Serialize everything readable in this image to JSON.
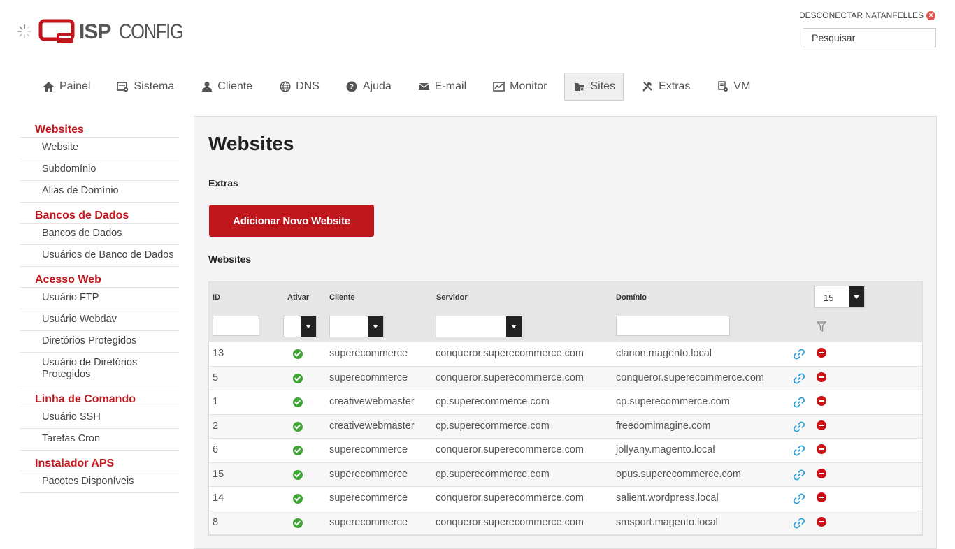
{
  "header": {
    "logo_text_bold": "ISP",
    "logo_text_light": "CONFIG",
    "logout_label": "DESCONECTAR NATANFELLES",
    "search_placeholder": "Pesquisar"
  },
  "nav": [
    {
      "label": "Painel",
      "icon": "home-icon"
    },
    {
      "label": "Sistema",
      "icon": "system-icon"
    },
    {
      "label": "Cliente",
      "icon": "user-icon"
    },
    {
      "label": "DNS",
      "icon": "globe-icon"
    },
    {
      "label": "Ajuda",
      "icon": "help-icon"
    },
    {
      "label": "E-mail",
      "icon": "envelope-icon"
    },
    {
      "label": "Monitor",
      "icon": "monitor-icon"
    },
    {
      "label": "Sites",
      "icon": "folder-icon",
      "active": true
    },
    {
      "label": "Extras",
      "icon": "tools-icon"
    },
    {
      "label": "VM",
      "icon": "vm-icon"
    }
  ],
  "sidebar": [
    {
      "title": "Websites",
      "items": [
        "Website",
        "Subdomínio",
        "Alias de Domínio"
      ]
    },
    {
      "title": "Bancos de Dados",
      "items": [
        "Bancos de Dados",
        "Usuários de Banco de Dados"
      ]
    },
    {
      "title": "Acesso Web",
      "items": [
        "Usuário FTP",
        "Usuário Webdav",
        "Diretórios Protegidos",
        "Usuário de Diretórios Protegidos"
      ]
    },
    {
      "title": "Linha de Comando",
      "items": [
        "Usuário SSH",
        "Tarefas Cron"
      ]
    },
    {
      "title": "Instalador APS",
      "items": [
        "Pacotes Disponíveis"
      ]
    }
  ],
  "main": {
    "title": "Websites",
    "extras_label": "Extras",
    "add_button": "Adicionar Novo Website",
    "list_label": "Websites",
    "columns": {
      "id": "ID",
      "active": "Ativar",
      "client": "Cliente",
      "server": "Servidor",
      "domain": "Domínio"
    },
    "per_page": "15",
    "rows": [
      {
        "id": "13",
        "client": "superecommerce",
        "server": "conqueror.superecommerce.com",
        "domain": "clarion.magento.local"
      },
      {
        "id": "5",
        "client": "superecommerce",
        "server": "conqueror.superecommerce.com",
        "domain": "conqueror.superecommerce.com"
      },
      {
        "id": "1",
        "client": "creativewebmaster",
        "server": "cp.superecommerce.com",
        "domain": "cp.superecommerce.com"
      },
      {
        "id": "2",
        "client": "creativewebmaster",
        "server": "cp.superecommerce.com",
        "domain": "freedomimagine.com"
      },
      {
        "id": "6",
        "client": "superecommerce",
        "server": "conqueror.superecommerce.com",
        "domain": "jollyany.magento.local"
      },
      {
        "id": "15",
        "client": "superecommerce",
        "server": "cp.superecommerce.com",
        "domain": "opus.superecommerce.com"
      },
      {
        "id": "14",
        "client": "superecommerce",
        "server": "conqueror.superecommerce.com",
        "domain": "salient.wordpress.local"
      },
      {
        "id": "8",
        "client": "superecommerce",
        "server": "conqueror.superecommerce.com",
        "domain": "smsport.magento.local"
      }
    ]
  },
  "colors": {
    "brand_red": "#c0171d",
    "check_green": "#3fa535",
    "link_blue": "#2a9fd6"
  }
}
